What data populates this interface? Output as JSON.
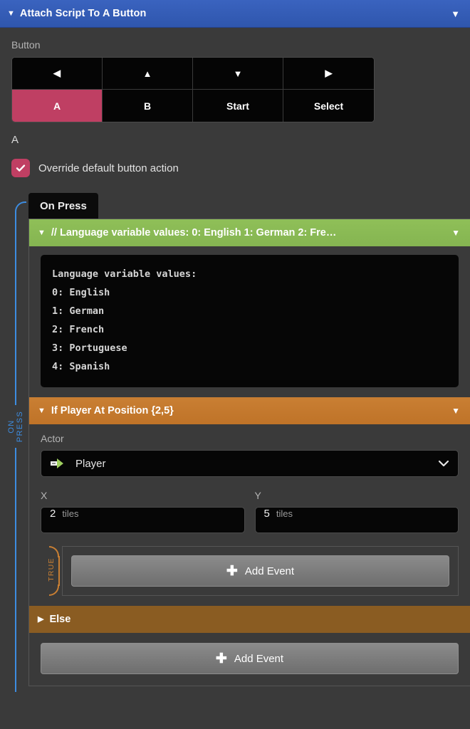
{
  "header": {
    "title": "Attach Script To A Button",
    "collapse_icon": "triangle-down-icon",
    "menu_icon": "triangle-down-icon",
    "accent_color": "#3a63bf"
  },
  "button_field": {
    "label": "Button",
    "rows": [
      [
        {
          "id": "left",
          "glyph": "◀",
          "icon": "arrow-left-icon",
          "selected": false
        },
        {
          "id": "up",
          "glyph": "▲",
          "icon": "arrow-up-icon",
          "selected": false
        },
        {
          "id": "down",
          "glyph": "▼",
          "icon": "arrow-down-icon",
          "selected": false
        },
        {
          "id": "right",
          "glyph": "▶",
          "icon": "arrow-right-icon",
          "selected": false
        }
      ],
      [
        {
          "id": "a",
          "glyph": "A",
          "icon": "",
          "selected": true
        },
        {
          "id": "b",
          "glyph": "B",
          "icon": "",
          "selected": false
        },
        {
          "id": "start",
          "glyph": "Start",
          "icon": "",
          "selected": false
        },
        {
          "id": "select",
          "glyph": "Select",
          "icon": "",
          "selected": false
        }
      ]
    ],
    "selected_label": "A",
    "selected_color": "#bf3f63"
  },
  "override": {
    "label": "Override default button action",
    "checked": true,
    "check_color": "#c03f63"
  },
  "tab": {
    "label": "On Press"
  },
  "on_press_rail": {
    "label": "ON PRESS",
    "color": "#3d8ce0"
  },
  "events": {
    "comment": {
      "header": "// Language variable values: 0: English 1: German 2: Fre…",
      "color": "#8fbf58",
      "collapse_icon": "triangle-down-icon",
      "menu_icon": "triangle-down-icon",
      "code_lines": [
        "Language variable values:",
        "0: English",
        "1: German",
        "2: French",
        "3: Portuguese",
        "4: Spanish"
      ]
    },
    "if_position": {
      "header": "If Player At Position {2,5}",
      "color": "#c97f33",
      "collapse_icon": "triangle-down-icon",
      "menu_icon": "triangle-down-icon",
      "actor": {
        "label": "Actor",
        "value": "Player",
        "icon": "actor-sprite-icon",
        "chevron": "chevron-down-icon"
      },
      "x": {
        "label": "X",
        "value": "2",
        "unit": "tiles"
      },
      "y": {
        "label": "Y",
        "value": "5",
        "unit": "tiles"
      },
      "true_branch": {
        "label": "TRUE",
        "add_event": "Add Event",
        "plus_icon": "plus-icon"
      },
      "else_branch": {
        "header": "Else",
        "color": "#8a5c22",
        "expand_icon": "triangle-right-icon"
      }
    },
    "footer_add_event": {
      "label": "Add Event",
      "plus_icon": "plus-icon"
    }
  }
}
